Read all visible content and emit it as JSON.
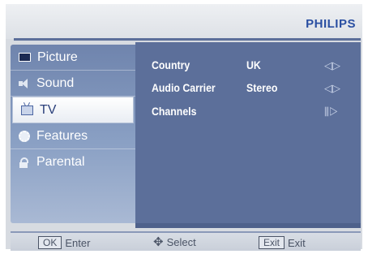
{
  "brand": "PHILIPS",
  "menu": [
    {
      "label": "Picture",
      "icon": "picture-icon"
    },
    {
      "label": "Sound",
      "icon": "sound-icon"
    },
    {
      "label": "TV",
      "icon": "tv-icon"
    },
    {
      "label": "Features",
      "icon": "features-icon"
    },
    {
      "label": "Parental",
      "icon": "parental-icon"
    }
  ],
  "selected_menu": "TV",
  "settings": [
    {
      "label": "Country",
      "value": "UK",
      "control": "◁▷"
    },
    {
      "label": "Audio Carrier",
      "value": "Stereo",
      "control": "◁▷"
    },
    {
      "label": "Channels",
      "value": "",
      "control": "⫼▷"
    }
  ],
  "footer": {
    "ok_key": "OK",
    "ok_label": "Enter",
    "select_icon": "✥",
    "select_label": "Select",
    "exit_key": "Exit",
    "exit_label": "Exit"
  },
  "colors": {
    "panel": "#5c6f9a",
    "brand": "#2a4fa2",
    "sidebar_top": "#6f84ad",
    "sidebar_bottom": "#a9b9d4"
  }
}
